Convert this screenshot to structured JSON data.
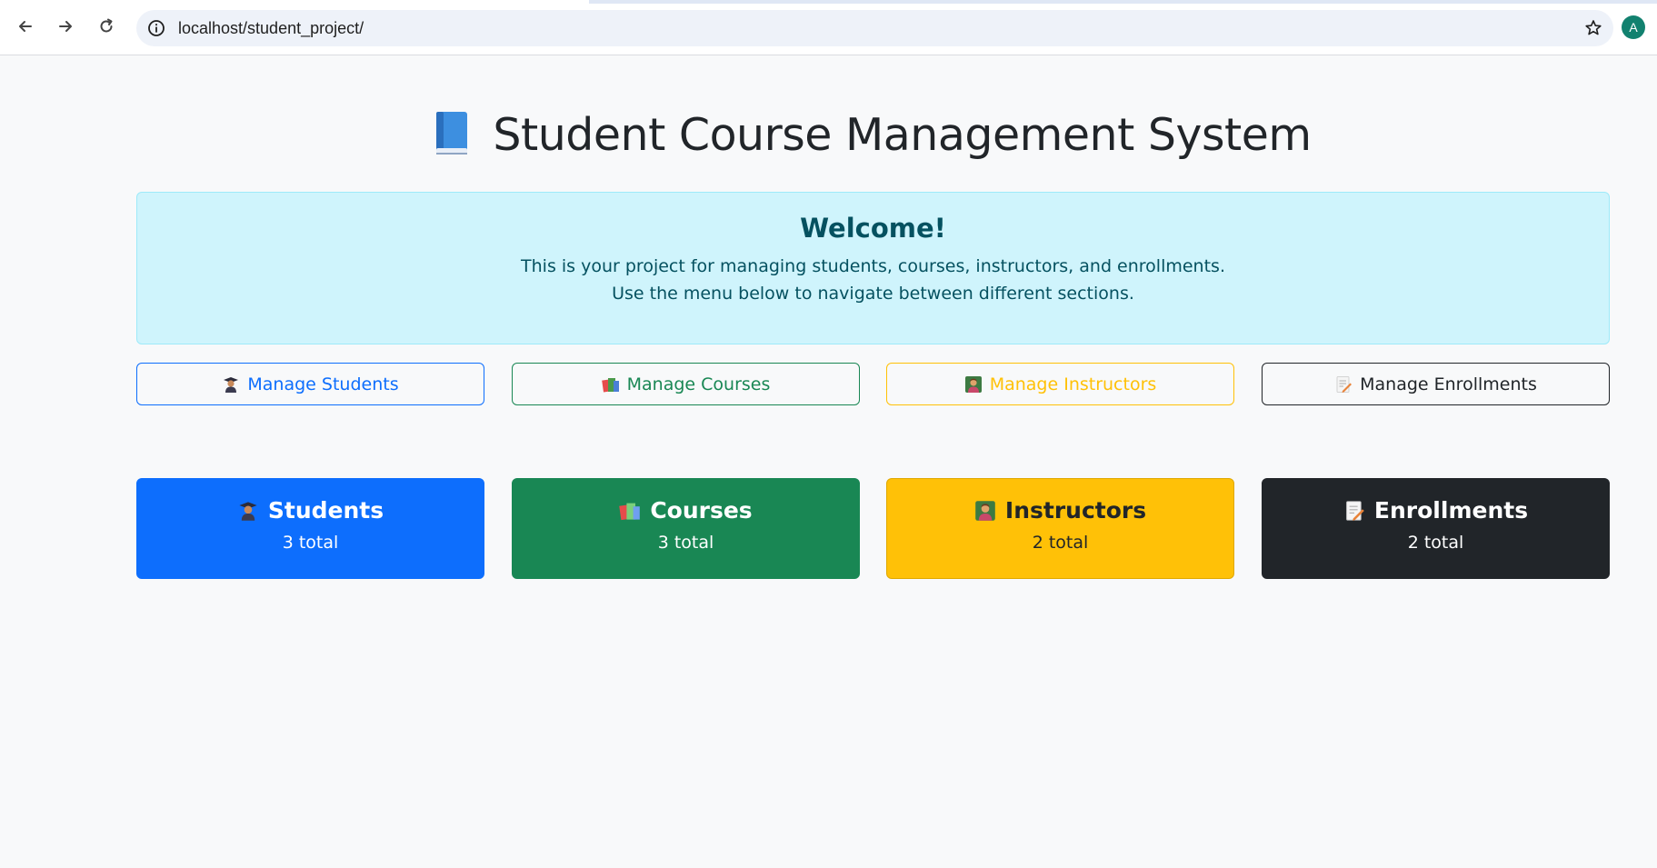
{
  "browser": {
    "url": "localhost/student_project/",
    "profile_initial": "A",
    "icons": [
      "back-arrow-icon",
      "forward-arrow-icon",
      "reload-icon",
      "site-info-icon",
      "bookmark-star-icon"
    ]
  },
  "page": {
    "title": "Student Course Management System",
    "title_icon": "blue-book-icon"
  },
  "welcome": {
    "heading": "Welcome!",
    "line1": "This is your project for managing students, courses, instructors, and enrollments.",
    "line2": "Use the menu below to navigate between different sections."
  },
  "menu": [
    {
      "label": "Manage Students",
      "icon": "student-icon",
      "color": "#0d6efd"
    },
    {
      "label": "Manage Courses",
      "icon": "books-icon",
      "color": "#198754"
    },
    {
      "label": "Manage Instructors",
      "icon": "teacher-icon",
      "color": "#ffc107"
    },
    {
      "label": "Manage Enrollments",
      "icon": "memo-icon",
      "color": "#212529"
    }
  ],
  "stats": [
    {
      "title": "Students",
      "count": "3 total",
      "icon": "student-icon",
      "color": "#0d6efd"
    },
    {
      "title": "Courses",
      "count": "3 total",
      "icon": "books-icon",
      "color": "#198754"
    },
    {
      "title": "Instructors",
      "count": "2 total",
      "icon": "teacher-icon",
      "color": "#ffc107"
    },
    {
      "title": "Enrollments",
      "count": "2 total",
      "icon": "memo-icon",
      "color": "#212529"
    }
  ]
}
